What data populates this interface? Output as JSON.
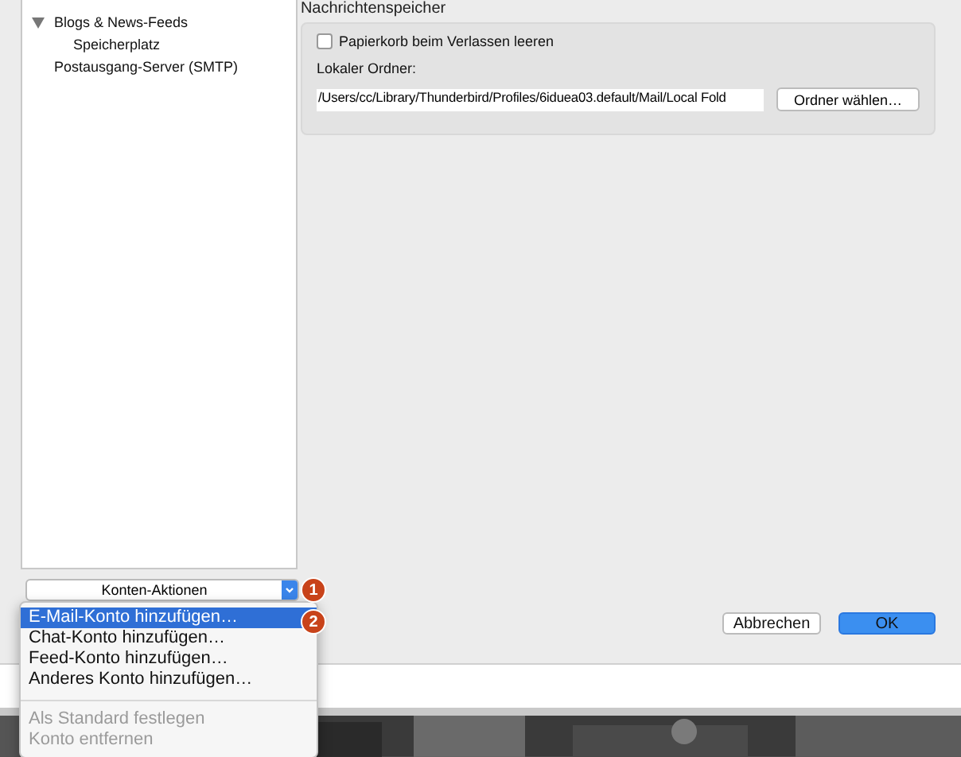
{
  "account_tree": [
    {
      "label": "Blogs & News-Feeds",
      "expanded": true,
      "children": [
        {
          "label": "Speicherplatz"
        }
      ]
    },
    {
      "label": "Postausgang-Server (SMTP)"
    }
  ],
  "account_actions_button": {
    "label": "Konten-Aktionen"
  },
  "message_store": {
    "heading": "Nachrichtenspeicher",
    "empty_trash": {
      "label": "Papierkorb beim Verlassen leeren",
      "checked": false
    },
    "local_folder_label": "Lokaler Ordner:",
    "local_folder_value": "/Users/cc/Library/Thunderbird/Profiles/6iduea03.default/Mail/Local Fold",
    "choose_button": "Ordner wählen…"
  },
  "buttons": [
    {
      "label": "Abbrechen",
      "kind": "secondary"
    },
    {
      "label": "OK",
      "kind": "primary"
    }
  ],
  "menu": {
    "groups": [
      [
        {
          "label": "E-Mail-Konto hinzufügen…",
          "selected": true,
          "disabled": false
        },
        {
          "label": "Chat-Konto hinzufügen…",
          "selected": false,
          "disabled": false
        },
        {
          "label": "Feed-Konto hinzufügen…",
          "selected": false,
          "disabled": false
        },
        {
          "label": "Anderes Konto hinzufügen…",
          "selected": false,
          "disabled": false
        }
      ],
      [
        {
          "label": "Als Standard festlegen",
          "selected": false,
          "disabled": true
        },
        {
          "label": "Konto entfernen",
          "selected": false,
          "disabled": true
        }
      ]
    ]
  },
  "callouts": [
    "1",
    "2"
  ]
}
